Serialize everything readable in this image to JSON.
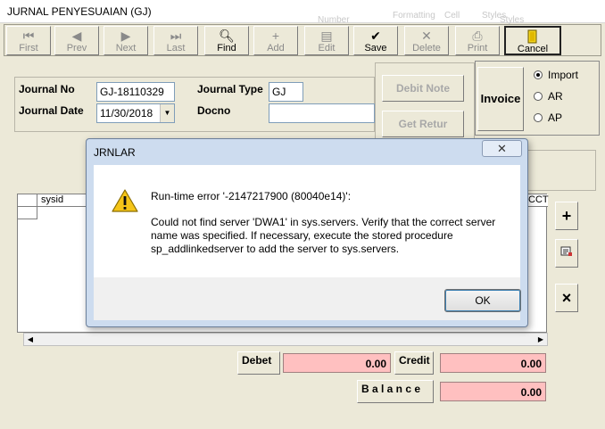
{
  "window": {
    "title": "JURNAL PENYESUAIAN (GJ)",
    "ghost_text": [
      "Formatting",
      "Cell",
      "Styles",
      "Number",
      "Styles"
    ]
  },
  "toolbar": {
    "first": "First",
    "prev": "Prev",
    "next": "Next",
    "last": "Last",
    "find": "Find",
    "add": "Add",
    "edit": "Edit",
    "save": "Save",
    "delete": "Delete",
    "print": "Print",
    "cancel": "Cancel"
  },
  "form": {
    "journal_no_label": "Journal No",
    "journal_no": "GJ-18110329",
    "journal_date_label": "Journal Date",
    "journal_date": "11/30/2018",
    "journal_type_label": "Journal Type",
    "journal_type": "GJ",
    "docno_label": "Docno",
    "docno": ""
  },
  "buttons": {
    "debit_note": "Debit Note",
    "get_retur": "Get Retur",
    "invoice": "Invoice"
  },
  "type_options": [
    {
      "label": "Import",
      "selected": true
    },
    {
      "label": "AR",
      "selected": false
    },
    {
      "label": "AP",
      "selected": false
    }
  ],
  "grid": {
    "columns": [
      "sysid",
      "CCT"
    ]
  },
  "side_buttons": {
    "add": "+",
    "edit": "edit-list-icon",
    "delete": "×"
  },
  "totals": {
    "debet_label": "Debet",
    "debet": "0.00",
    "credit_label": "Credit",
    "credit": "0.00",
    "balance_label": "B a l a n c e",
    "balance": "0.00"
  },
  "dialog": {
    "title": "JRNLAR",
    "close": "✕",
    "heading": "Run-time error '-2147217900 (80040e14)':",
    "message": "Could not find server 'DWA1' in sys.servers. Verify that the correct server name was specified. If necessary, execute the stored procedure sp_addlinkedserver to add the server to sys.servers.",
    "ok": "OK"
  }
}
